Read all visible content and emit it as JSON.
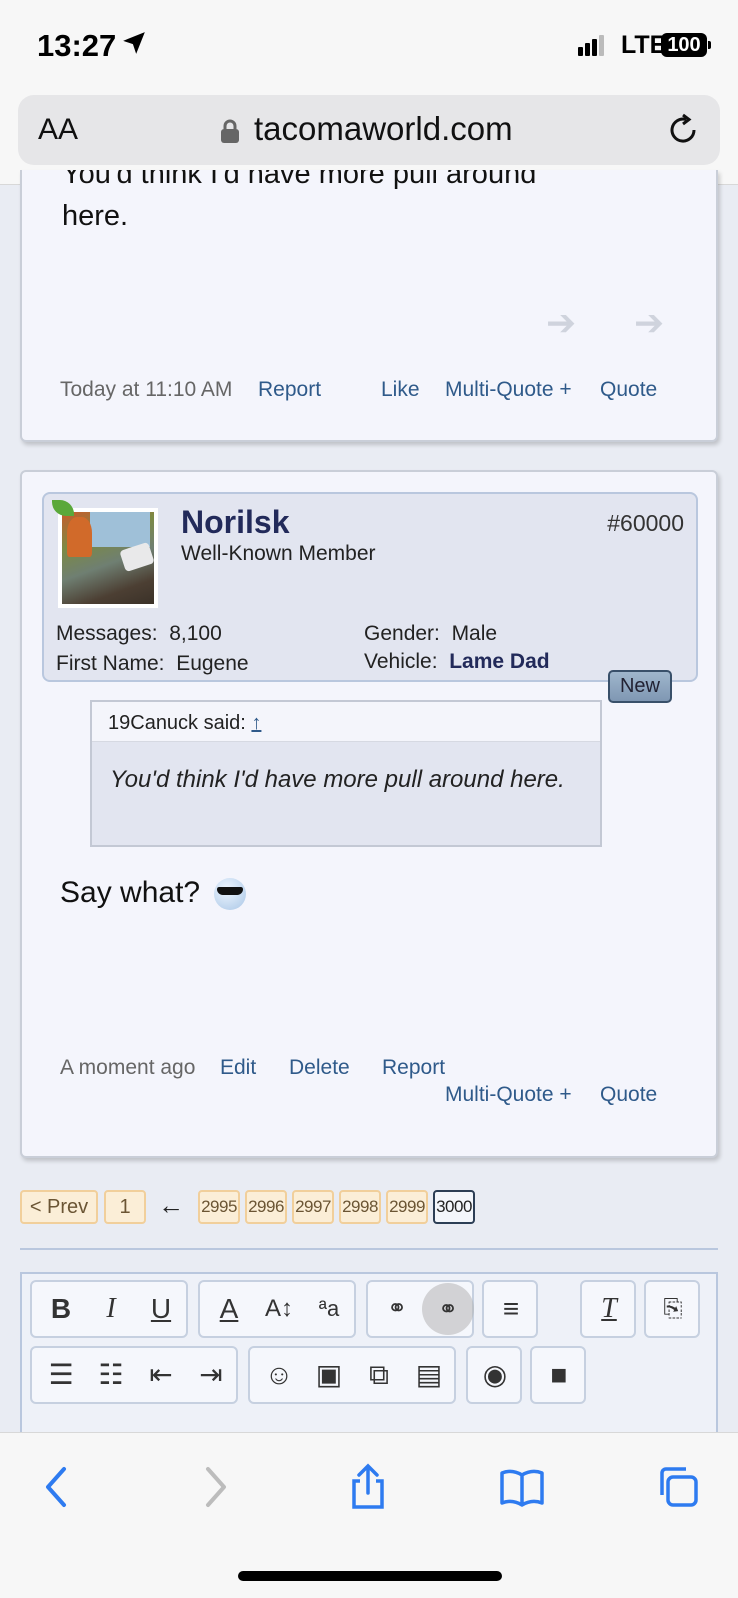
{
  "status_bar": {
    "time": "13:27",
    "network": "LTE",
    "battery": "100"
  },
  "browser": {
    "text_size_label": "AA",
    "domain": "tacomaworld.com"
  },
  "previous_post": {
    "cut_line": "You'd think I'd have more pull around",
    "body_tail": "here.",
    "timestamp": "Today at 11:10 AM",
    "report": "Report",
    "like": "Like",
    "multi_quote": "Multi-Quote +",
    "quote": "Quote"
  },
  "post": {
    "username": "Norilsk",
    "user_title": "Well-Known Member",
    "post_number": "#60000",
    "messages_label": "Messages:",
    "messages_value": "8,100",
    "first_name_label": "First Name:",
    "first_name_value": "Eugene",
    "gender_label": "Gender:",
    "gender_value": "Male",
    "vehicle_label": "Vehicle:",
    "vehicle_value": "Lame Dad",
    "new_badge": "New",
    "quote_author": "19Canuck said:",
    "quote_up": "↑",
    "quote_text": "You'd think I'd have more pull around here.",
    "body": "Say what?",
    "timestamp": "A moment ago",
    "edit": "Edit",
    "delete": "Delete",
    "report": "Report",
    "multi_quote": "Multi-Quote +",
    "quote": "Quote"
  },
  "pagination": {
    "prev": "< Prev",
    "first": "1",
    "ellipsis_arrow": "←",
    "pages": [
      "2995",
      "2996",
      "2997",
      "2998",
      "2999"
    ],
    "current": "3000"
  },
  "editor_toolbar": {
    "row1": [
      "bold-icon",
      "italic-icon",
      "underline-icon",
      "text-color-icon",
      "font-size-icon",
      "font-family-icon",
      "link-icon",
      "unlink-icon",
      "align-icon",
      "remove-format-icon",
      "smilie-manager-icon"
    ],
    "row2": [
      "bullet-list-icon",
      "numbered-list-icon",
      "outdent-icon",
      "indent-icon",
      "smilie-icon",
      "image-icon",
      "media-icon",
      "insert-quote-icon",
      "camera-icon",
      "save-draft-icon"
    ]
  }
}
